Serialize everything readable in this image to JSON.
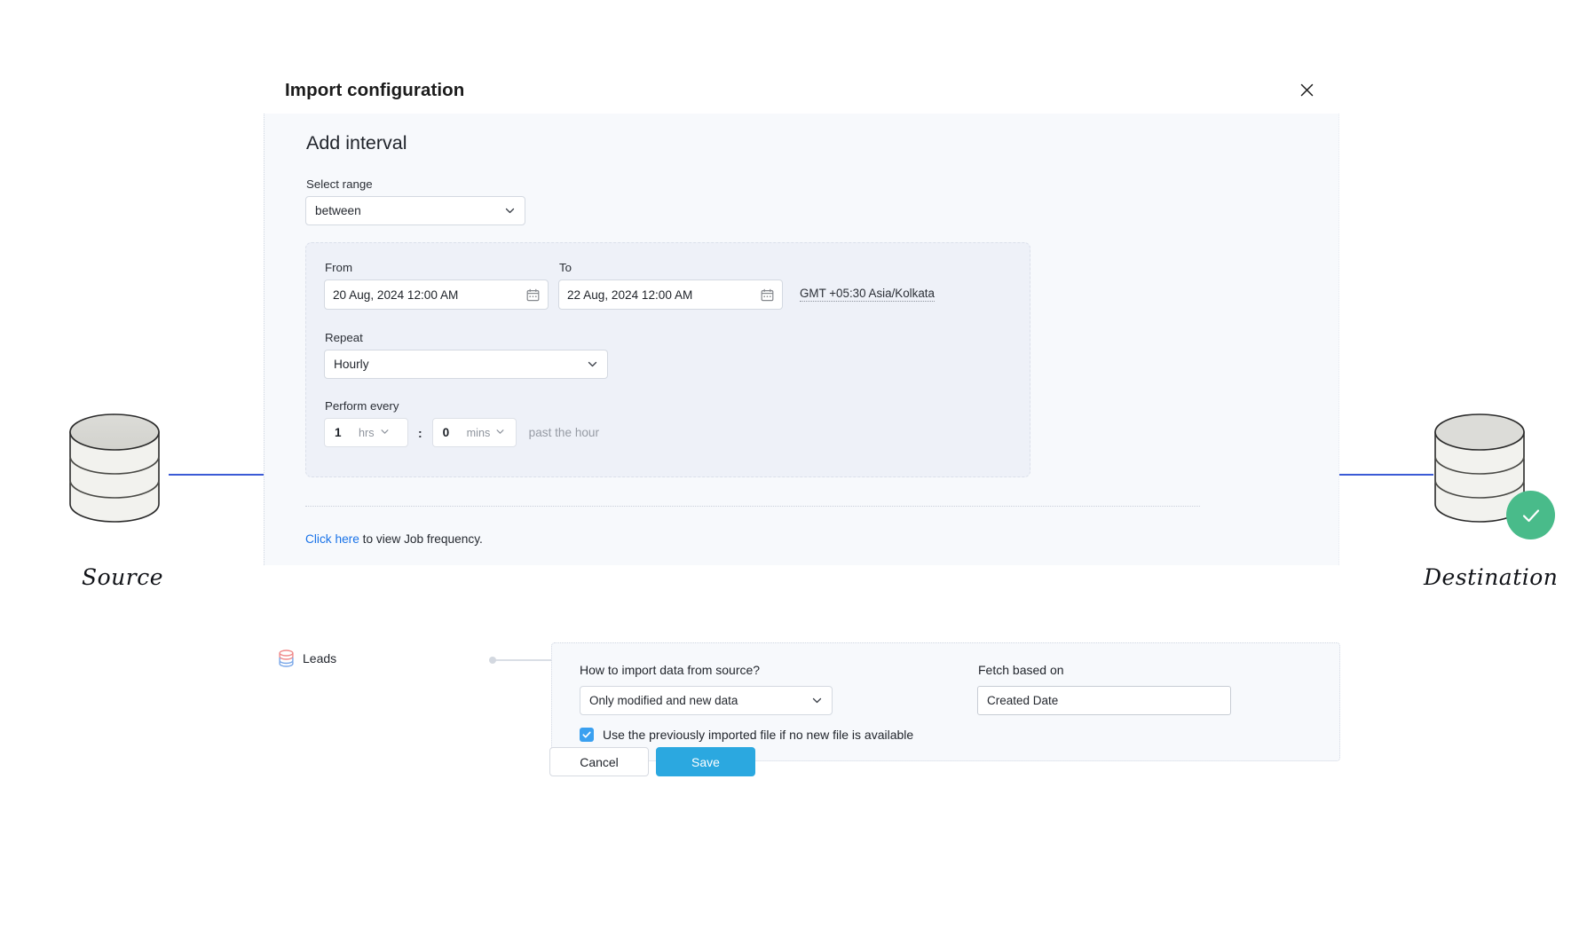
{
  "dialog": {
    "title": "Import configuration",
    "close_icon": "close-icon"
  },
  "interval": {
    "heading": "Add interval",
    "select_range_label": "Select range",
    "select_range_value": "between",
    "from_label": "From",
    "from_value": "20 Aug, 2024 12:00 AM",
    "to_label": "To",
    "to_value": "22 Aug, 2024 12:00 AM",
    "timezone": "GMT +05:30 Asia/Kolkata",
    "repeat_label": "Repeat",
    "repeat_value": "Hourly",
    "perform_every_label": "Perform every",
    "hours_value": "1",
    "hours_unit": "hrs",
    "separator": ":",
    "minutes_value": "0",
    "minutes_unit": "mins",
    "past_the_hour": "past the hour",
    "link_text": "Click here",
    "link_suffix": " to view Job frequency."
  },
  "leads": {
    "module_name": "Leads",
    "module_icon": "database-stack-icon",
    "how_import_label": "How to import data from source?",
    "how_import_value": "Only modified and new data",
    "fetch_based_label": "Fetch based on",
    "fetch_based_value": "Created Date",
    "checkbox_label": "Use the previously imported file if no new file is available",
    "checkbox_checked": true
  },
  "actions": {
    "cancel": "Cancel",
    "save": "Save"
  },
  "diagram": {
    "source_label": "Source",
    "destination_label": "Destination",
    "source_icon": "database-cylinder-icon",
    "destination_icon": "database-cylinder-icon",
    "status_icon": "check-circle-icon"
  },
  "colors": {
    "save_blue": "#2ba8e0",
    "link_blue": "#1a73e8",
    "checkbox_blue": "#3aa0f0",
    "success_green": "#49bb8a",
    "wire_blue": "#3b5bd6",
    "panel_bg": "#f7f9fc",
    "interval_box_bg": "#eef1f8"
  }
}
